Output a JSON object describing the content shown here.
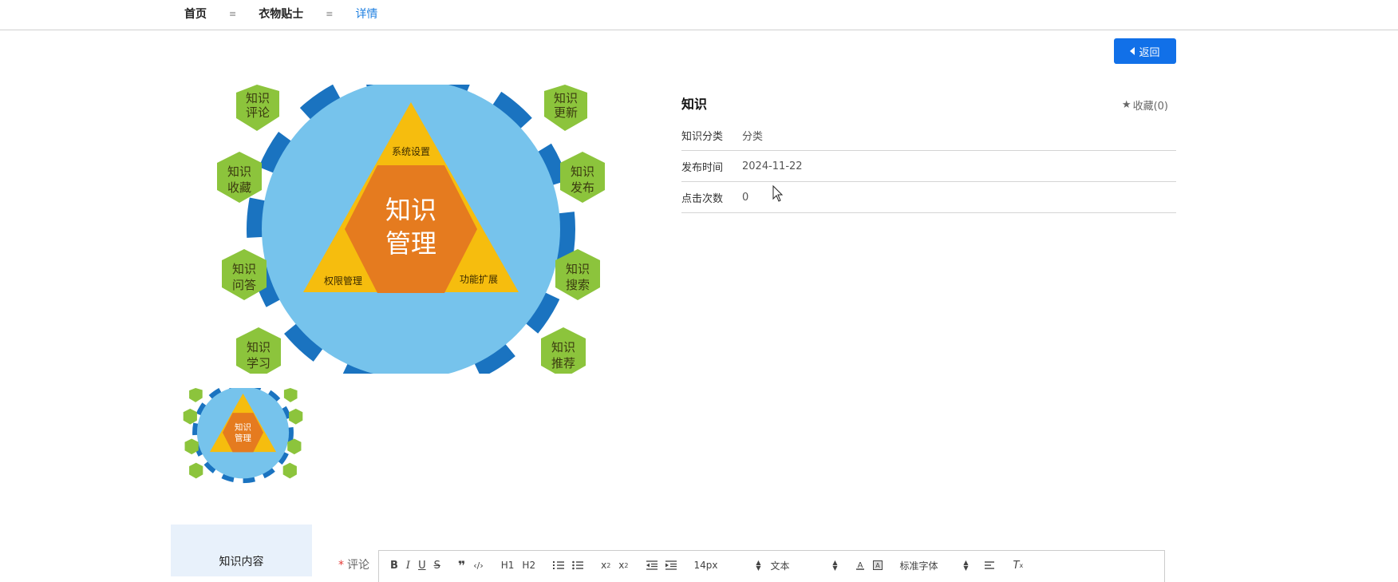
{
  "breadcrumb": {
    "items": [
      {
        "label": "首页",
        "active": false
      },
      {
        "label": "衣物贴士",
        "active": false
      },
      {
        "label": "详情",
        "active": true
      }
    ],
    "separator": "≡"
  },
  "actions": {
    "back_label": "返回"
  },
  "image": {
    "center_text": [
      "知识",
      "管理"
    ],
    "triangle_labels": [
      "系统设置",
      "权限管理",
      "功能扩展"
    ],
    "hexagons": [
      [
        "知识",
        "评论"
      ],
      [
        "知识",
        "更新"
      ],
      [
        "知识",
        "收藏"
      ],
      [
        "知识",
        "发布"
      ],
      [
        "知识",
        "问答"
      ],
      [
        "知识",
        "搜索"
      ],
      [
        "知识",
        "学习"
      ],
      [
        "知识",
        "推荐"
      ]
    ],
    "colors": {
      "circle": "#76c3ec",
      "hexagon": "#8cc43c",
      "triangle_outer": "#f6bd0e",
      "hexagon_center": "#e57b1f",
      "ring": "#1a73c0"
    }
  },
  "detail": {
    "title": "知识",
    "favorite_label": "收藏(0)",
    "rows": [
      {
        "label": "知识分类",
        "value": "分类"
      },
      {
        "label": "发布时间",
        "value": "2024-11-22"
      },
      {
        "label": "点击次数",
        "value": "0"
      }
    ]
  },
  "tabs": {
    "content_label": "知识内容"
  },
  "comment": {
    "label": "评论",
    "required_mark": "*",
    "toolbar": {
      "font_size": "14px",
      "text_style": "文本",
      "font_family": "标准字体",
      "h1": "H1",
      "h2": "H2"
    }
  }
}
